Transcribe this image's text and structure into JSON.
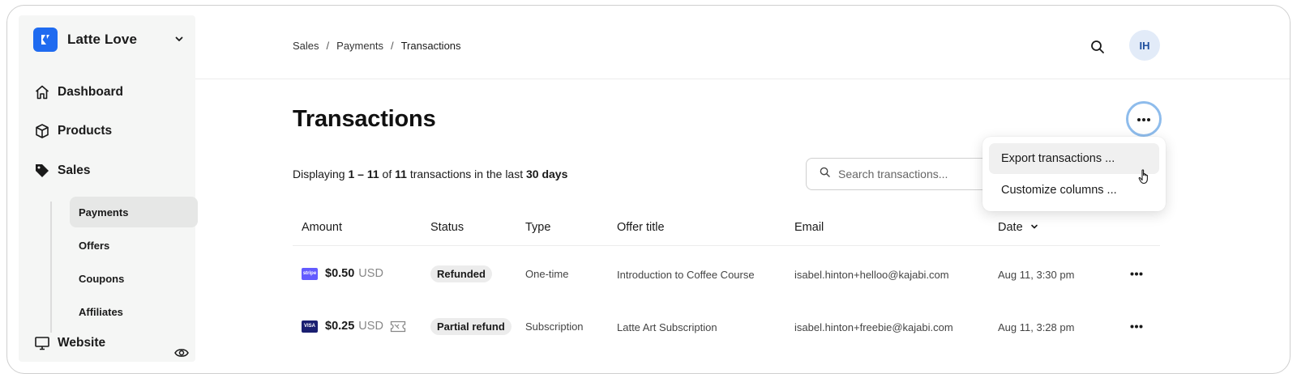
{
  "brand": {
    "name": "Latte Love",
    "accent": "#1f6bf0"
  },
  "nav": {
    "dashboard": "Dashboard",
    "products": "Products",
    "sales": "Sales",
    "website": "Website",
    "sub_items": [
      "Payments",
      "Offers",
      "Coupons",
      "Affiliates"
    ],
    "active_sub": "Payments"
  },
  "breadcrumb": [
    "Sales",
    "Payments",
    "Transactions"
  ],
  "breadcrumb_sep": "/",
  "user": {
    "initials": "IH"
  },
  "page": {
    "title": "Transactions",
    "display_prefix": "Displaying",
    "display_range": "1 – 11",
    "display_of": "of",
    "display_total": "11",
    "display_mid": "transactions in the last",
    "display_period": "30 days"
  },
  "search": {
    "placeholder": "Search transactions..."
  },
  "menu": {
    "items": [
      "Export transactions ...",
      "Customize columns ..."
    ]
  },
  "table": {
    "headers": [
      "Amount",
      "Status",
      "Type",
      "Offer title",
      "Email",
      "Date"
    ],
    "rows": [
      {
        "card": "stripe",
        "card_label": "stripe",
        "amount": "$0.50",
        "currency": "USD",
        "status": "Refunded",
        "type": "One-time",
        "offer": "Introduction to Coffee Course",
        "email": "isabel.hinton+helloo@kajabi.com",
        "date": "Aug 11, 3:30 pm"
      },
      {
        "card": "visa",
        "card_label": "VISA",
        "amount": "$0.25",
        "currency": "USD",
        "status": "Partial refund",
        "type": "Subscription",
        "offer": "Latte Art Subscription",
        "email": "isabel.hinton+freebie@kajabi.com",
        "date": "Aug 11, 3:28 pm"
      }
    ]
  }
}
